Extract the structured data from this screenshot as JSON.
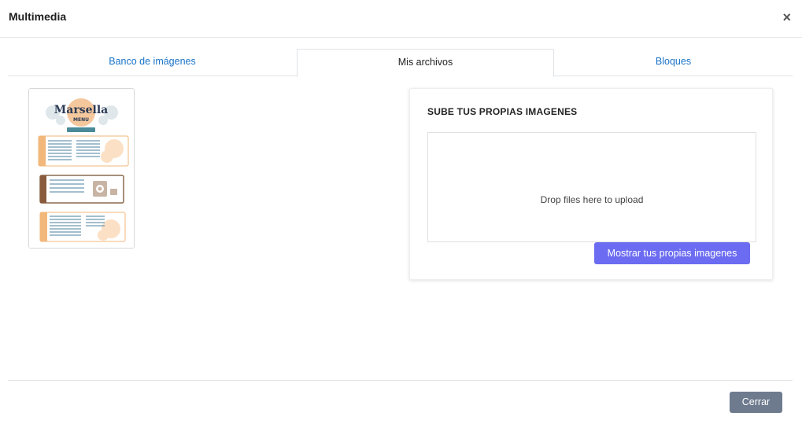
{
  "modal": {
    "title": "Multimedia",
    "close_glyph": "×"
  },
  "tabs": [
    {
      "label": "Banco de imágenes",
      "active": false
    },
    {
      "label": "Mis archivos",
      "active": true
    },
    {
      "label": "Bloques",
      "active": false
    }
  ],
  "files": [
    {
      "preview_title": "Marsella",
      "preview_subtitle": "MENU",
      "kind": "menu-image"
    }
  ],
  "upload": {
    "title": "SUBE TUS PROPIAS IMAGENES",
    "dropzone_text": "Drop files here to upload",
    "show_button_label": "Mostrar tus propias imagenes"
  },
  "footer": {
    "close_label": "Cerrar"
  },
  "colors": {
    "tab_link": "#1a73c9",
    "primary_button": "#6c6cf2",
    "secondary_button": "#6e7a8e"
  }
}
